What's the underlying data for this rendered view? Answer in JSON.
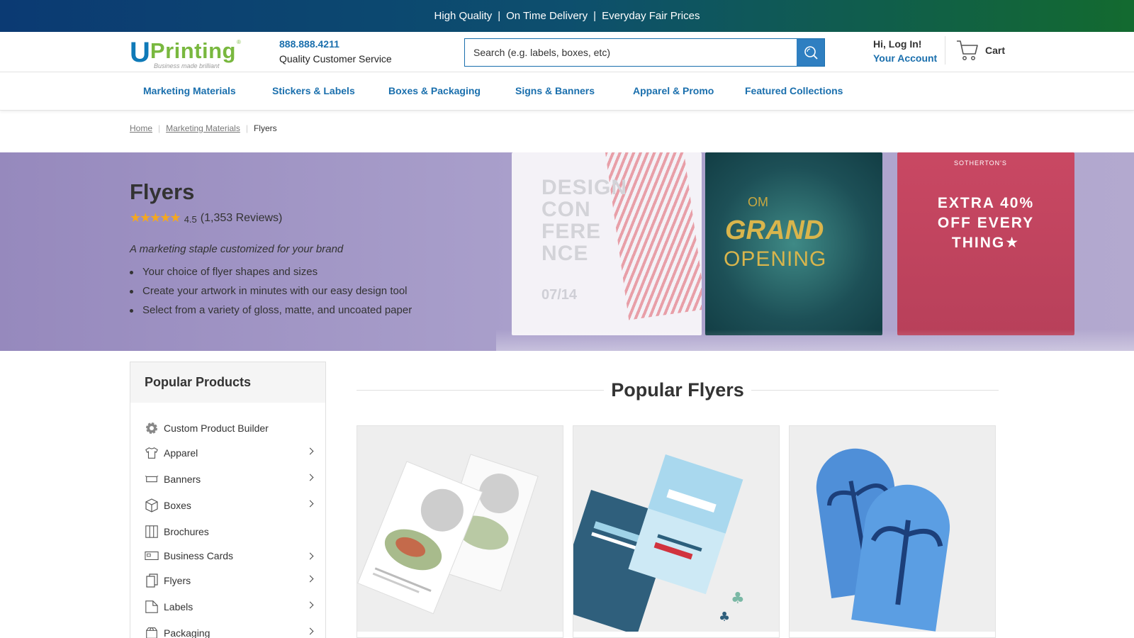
{
  "promo": {
    "items": [
      "High Quality",
      "On Time Delivery",
      "Everyday Fair Prices"
    ],
    "separator": "|"
  },
  "header": {
    "logo_u": "U",
    "logo_text": "Printing",
    "logo_reg": "®",
    "logo_tagline": "Business made brilliant",
    "phone": "888.888.4211",
    "service_text": "Quality Customer Service",
    "search_placeholder": "Search (e.g. labels, boxes, etc)",
    "greeting": "Hi, Log In!",
    "account_link": "Your Account",
    "cart_label": "Cart"
  },
  "nav": {
    "items": [
      "Marketing Materials",
      "Stickers & Labels",
      "Boxes & Packaging",
      "Signs & Banners",
      "Apparel & Promo",
      "Featured Collections"
    ]
  },
  "breadcrumb": {
    "home": "Home",
    "parent": "Marketing Materials",
    "current": "Flyers"
  },
  "hero": {
    "title": "Flyers",
    "stars": "★★★★★",
    "rating": "4.5",
    "reviews": "(1,353 Reviews)",
    "tagline": "A marketing staple customized for your brand",
    "bullets": [
      "Your choice of flyer shapes and sizes",
      "Create your artwork in minutes with our easy design tool",
      "Select from a variety of gloss, matte, and uncoated paper"
    ],
    "poster1_text": "DESIGN CON FERE NCE",
    "poster1_date": "07/14",
    "poster2_top": "OM",
    "poster2_main": "GRAND",
    "poster2_sub": "OPENING",
    "poster3_brand": "SOTHERTON'S",
    "poster3_text": "EXTRA 40% OFF EVERY THING★"
  },
  "sidebar": {
    "title": "Popular Products",
    "items": [
      {
        "label": "Custom Product Builder",
        "icon": "gear-icon",
        "has_sub": false
      },
      {
        "label": "Apparel",
        "icon": "tshirt-icon",
        "has_sub": true
      },
      {
        "label": "Banners",
        "icon": "banner-icon",
        "has_sub": true
      },
      {
        "label": "Boxes",
        "icon": "box-icon",
        "has_sub": true
      },
      {
        "label": "Brochures",
        "icon": "brochure-icon",
        "has_sub": false
      },
      {
        "label": "Business Cards",
        "icon": "business-card-icon",
        "has_sub": true
      },
      {
        "label": "Flyers",
        "icon": "flyer-icon",
        "has_sub": true
      },
      {
        "label": "Labels",
        "icon": "label-icon",
        "has_sub": true
      },
      {
        "label": "Packaging",
        "icon": "packaging-icon",
        "has_sub": true
      }
    ]
  },
  "main": {
    "section_title": "Popular Flyers",
    "cards": [
      {
        "name": "restaurant-flyer"
      },
      {
        "name": "club-flyer"
      },
      {
        "name": "arched-flyer"
      }
    ]
  },
  "colors": {
    "brand_blue": "#1a6fad",
    "brand_green": "#79b83f",
    "star": "#f4a720",
    "hero_bg": "#a99fcb"
  }
}
